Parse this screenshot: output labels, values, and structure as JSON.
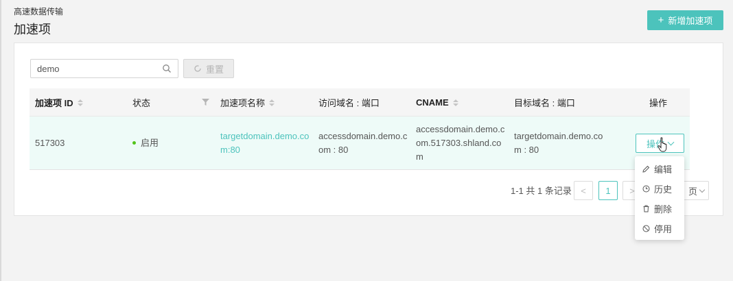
{
  "header": {
    "breadcrumb": "高速数据传输",
    "title": "加速项",
    "add_button": "新增加速项"
  },
  "toolbar": {
    "search_value": "demo",
    "reset_label": "重置"
  },
  "table": {
    "columns": [
      "加速项 ID",
      "状态",
      "加速项名称",
      "访问域名 : 端口",
      "CNAME",
      "目标域名 : 端口",
      "操作"
    ],
    "rows": [
      {
        "id": "517303",
        "status": "启用",
        "name": "targetdomain.demo.com:80",
        "access": "accessdomain.demo.com : 80",
        "cname": "accessdomain.demo.com.517303.shland.com",
        "target": "targetdomain.demo.com : 80",
        "action": "操作"
      }
    ]
  },
  "pagination": {
    "summary": "1-1 共 1 条记录",
    "prev": "<",
    "current_page": "1",
    "next": ">",
    "page_size_suffix": "页"
  },
  "dropdown": {
    "items": [
      {
        "label": "编辑",
        "icon": "edit-icon"
      },
      {
        "label": "历史",
        "icon": "history-icon"
      },
      {
        "label": "删除",
        "icon": "delete-icon"
      },
      {
        "label": "停用",
        "icon": "disable-icon"
      }
    ]
  },
  "colors": {
    "accent": "#4cc3bc",
    "row_highlight": "#eefbf8",
    "status_enabled": "#52c41a"
  }
}
